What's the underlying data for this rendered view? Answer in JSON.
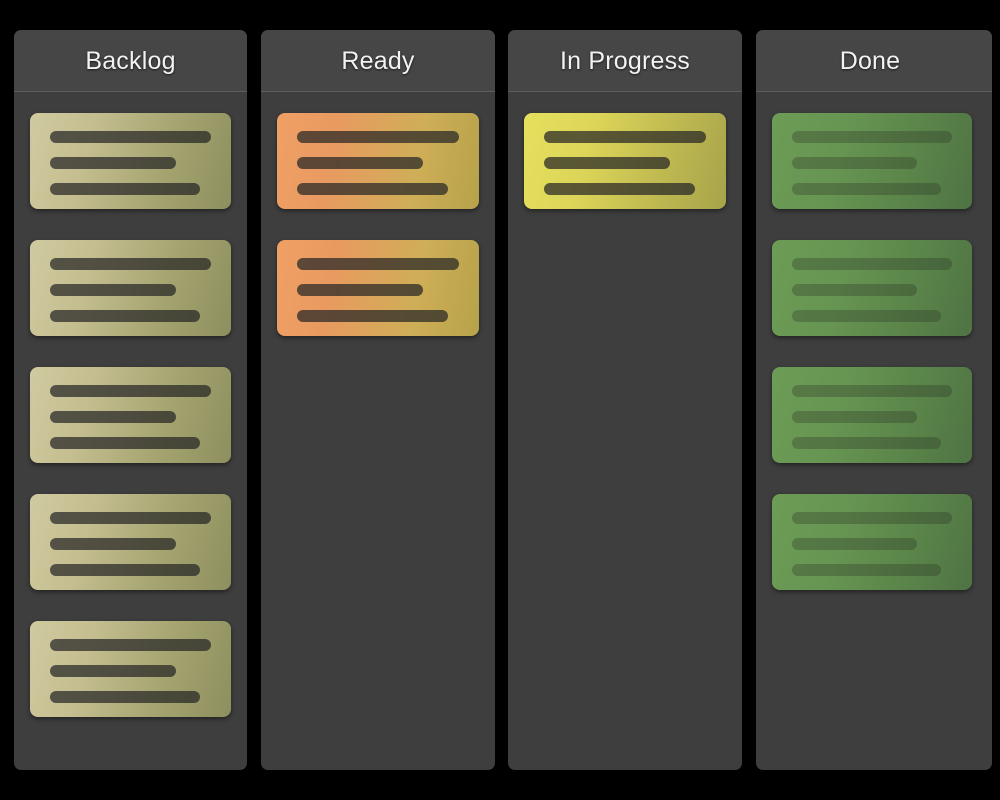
{
  "board": {
    "background_color": "#000000",
    "column_background": "#3e3e3e",
    "column_header_background": "#464646",
    "header_divider_color": "#5e5e5e",
    "title_color": "#f2f2f2"
  },
  "columns": [
    {
      "id": "backlog",
      "title": "Backlog",
      "variant": "backlog",
      "accent_from": "#d0caa0",
      "accent_to": "#8d8f5e",
      "card_count": 5,
      "cards": [
        {
          "bars": [
            100,
            78,
            93
          ]
        },
        {
          "bars": [
            100,
            78,
            93
          ]
        },
        {
          "bars": [
            100,
            78,
            93
          ]
        },
        {
          "bars": [
            100,
            78,
            93
          ]
        },
        {
          "bars": [
            100,
            78,
            93
          ]
        }
      ]
    },
    {
      "id": "ready",
      "title": "Ready",
      "variant": "ready",
      "accent_from": "#f0a065",
      "accent_to": "#b6a24a",
      "card_count": 2,
      "cards": [
        {
          "bars": [
            100,
            78,
            93
          ]
        },
        {
          "bars": [
            100,
            78,
            93
          ]
        }
      ]
    },
    {
      "id": "inprogress",
      "title": "In Progress",
      "variant": "inprogress",
      "accent_from": "#e6e05e",
      "accent_to": "#a7a34a",
      "card_count": 1,
      "cards": [
        {
          "bars": [
            100,
            78,
            93
          ]
        }
      ]
    },
    {
      "id": "done",
      "title": "Done",
      "variant": "done",
      "accent_from": "#6c9c56",
      "accent_to": "#4f7344",
      "card_count": 4,
      "cards": [
        {
          "bars": [
            100,
            78,
            93
          ]
        },
        {
          "bars": [
            100,
            78,
            93
          ]
        },
        {
          "bars": [
            100,
            78,
            93
          ]
        },
        {
          "bars": [
            100,
            78,
            93
          ]
        }
      ]
    }
  ]
}
